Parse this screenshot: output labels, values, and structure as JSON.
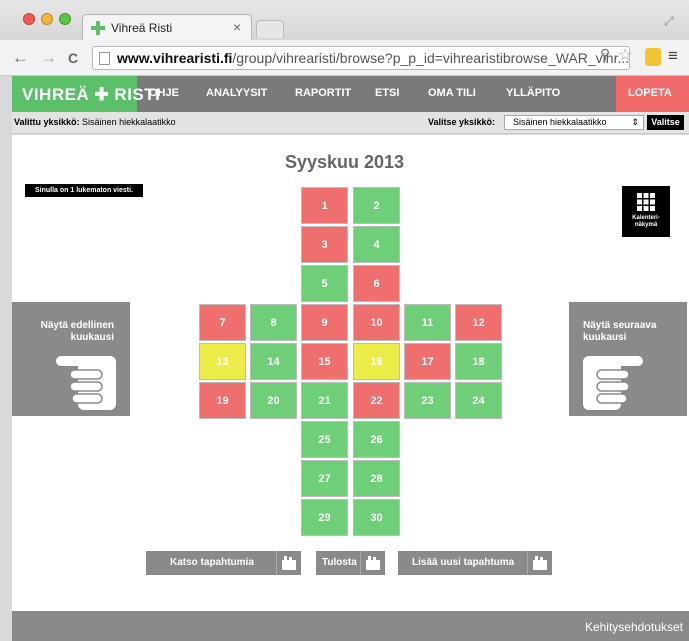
{
  "browser": {
    "tab_title": "Vihreä Risti",
    "tab_close": "×",
    "url_domain": "www.vihrearisti.fi",
    "url_path": "/group/vihrearisti/browse?p_p_id=vihrearistibrowse_WAR_vihr...",
    "back": "←",
    "forward": "→",
    "reload": "C"
  },
  "nav": {
    "logo": "VIHREÄ ✚ RISTI",
    "items": [
      "OHJE",
      "ANALYYSIT",
      "RAPORTIT",
      "ETSI",
      "OMA TILI",
      "YLLÄPITO"
    ],
    "logout": "LOPETA"
  },
  "unitbar": {
    "selected_label": "Valittu yksikkö:",
    "selected_value": "Sisäinen hiekkalaatikko",
    "choose_label": "Valitse yksikkö:",
    "choose_value": "Sisäinen hiekkalaatikko",
    "choose_button": "Valitse"
  },
  "calendar": {
    "month_title": "Syyskuu 2013",
    "message": "Sinulla on 1 lukematon viesti.",
    "calendar_view": "Kalenteri-\nnäkymä",
    "prev_month": "Näytä edellinen\nkuukausi",
    "next_month": "Näytä seuraava\nkuukausi",
    "days": [
      {
        "day": "1",
        "status": "red"
      },
      {
        "day": "2",
        "status": "green"
      },
      {
        "day": "3",
        "status": "red"
      },
      {
        "day": "4",
        "status": "green"
      },
      {
        "day": "5",
        "status": "green"
      },
      {
        "day": "6",
        "status": "red"
      },
      {
        "day": "7",
        "status": "red"
      },
      {
        "day": "8",
        "status": "green"
      },
      {
        "day": "9",
        "status": "red"
      },
      {
        "day": "10",
        "status": "red"
      },
      {
        "day": "11",
        "status": "green"
      },
      {
        "day": "12",
        "status": "red"
      },
      {
        "day": "13",
        "status": "yellow"
      },
      {
        "day": "14",
        "status": "green"
      },
      {
        "day": "15",
        "status": "red"
      },
      {
        "day": "16",
        "status": "yellow"
      },
      {
        "day": "17",
        "status": "red"
      },
      {
        "day": "18",
        "status": "green"
      },
      {
        "day": "19",
        "status": "red"
      },
      {
        "day": "20",
        "status": "green"
      },
      {
        "day": "21",
        "status": "green"
      },
      {
        "day": "22",
        "status": "red"
      },
      {
        "day": "23",
        "status": "green"
      },
      {
        "day": "24",
        "status": "green"
      },
      {
        "day": "25",
        "status": "green"
      },
      {
        "day": "26",
        "status": "green"
      },
      {
        "day": "27",
        "status": "green"
      },
      {
        "day": "28",
        "status": "green"
      },
      {
        "day": "29",
        "status": "green"
      },
      {
        "day": "30",
        "status": "green"
      }
    ]
  },
  "actions": {
    "view_events": "Katso tapahtumia",
    "print": "Tulosta",
    "add_event": "Lisää uusi tapahtuma"
  },
  "footer": {
    "feedback": "Kehitysehdotukset"
  },
  "colors": {
    "red": "#ef6f6f",
    "green": "#6fcf78",
    "yellow": "#ecec49",
    "brand_green": "#5cc06a",
    "logout_red": "#f26b6b"
  }
}
